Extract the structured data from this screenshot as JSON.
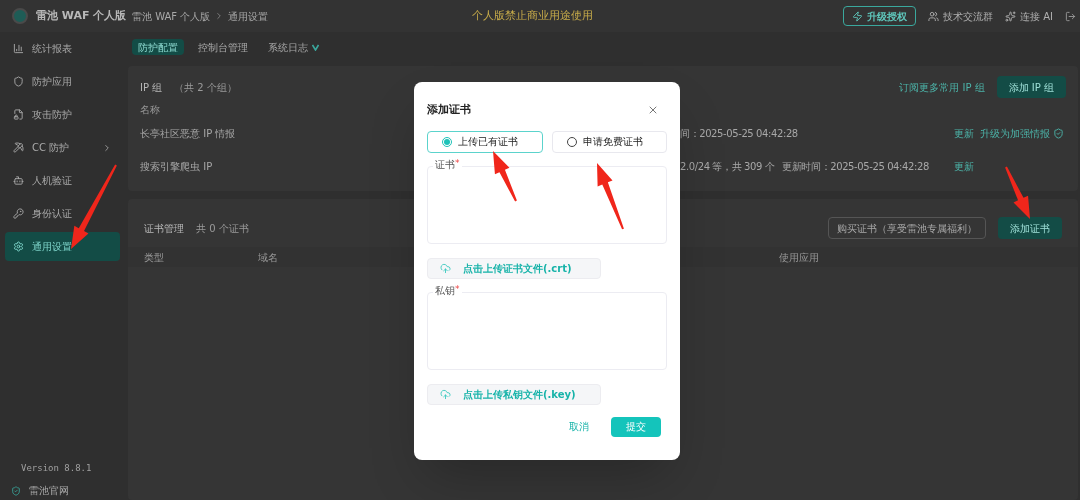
{
  "header": {
    "product": "雷池 WAF 个人版",
    "breadcrumb": [
      "雷池 WAF 个人版",
      "通用设置"
    ],
    "notice": "个人版禁止商业用途使用",
    "actions": [
      {
        "kind": "upgrade",
        "label": "升级授权"
      },
      {
        "kind": "group",
        "label": "技术交流群"
      },
      {
        "kind": "ai",
        "label": "连接 AI"
      }
    ]
  },
  "sidebar": {
    "items": [
      {
        "label": "统计报表",
        "selected": false,
        "expandable": false
      },
      {
        "label": "防护应用",
        "selected": false,
        "expandable": false
      },
      {
        "label": "攻击防护",
        "selected": false,
        "expandable": false
      },
      {
        "label": "CC 防护",
        "selected": false,
        "expandable": true
      },
      {
        "label": "人机验证",
        "selected": false,
        "expandable": false
      },
      {
        "label": "身份认证",
        "selected": false,
        "expandable": false
      },
      {
        "label": "通用设置",
        "selected": true,
        "expandable": false
      }
    ],
    "version": "Version 8.8.1",
    "footer_link": "雷池官网"
  },
  "tabs": [
    {
      "label": "防护配置",
      "selected": true,
      "badge": false
    },
    {
      "label": "控制台管理",
      "selected": false,
      "badge": false
    },
    {
      "label": "系统日志",
      "selected": false,
      "badge": true
    }
  ],
  "ip_group": {
    "title": "IP 组",
    "count": "（共 2 个组）",
    "subscribe_link": "订阅更多常用 IP 组",
    "add_button": "添加 IP 组",
    "columns": [
      "名称"
    ],
    "rows": [
      {
        "name": "长亭社区恶意 IP 情报",
        "details": [
          "间：2025-05-25 04:42:28"
        ],
        "action": "更新",
        "upgrade": "升级为加强情报"
      },
      {
        "name": "搜索引擎爬虫 IP",
        "details": [
          "2.0/24 等，共 309 个",
          "更新时间：2025-05-25 04:42:28"
        ],
        "action": "更新"
      }
    ]
  },
  "certificates": {
    "title": "证书管理",
    "count": "共 0 个证书",
    "buy_button": "购买证书（享受雷池专属福利）",
    "add_button": "添加证书",
    "columns": [
      "类型",
      "域名",
      "使用应用"
    ]
  },
  "dialog": {
    "title": "添加证书",
    "options": [
      {
        "label": "上传已有证书",
        "selected": true
      },
      {
        "label": "申请免费证书",
        "selected": false
      }
    ],
    "cert_field": {
      "label": "证书",
      "required": true,
      "required_mark": "*"
    },
    "cert_upload": "点击上传证书文件(.crt)",
    "key_field": {
      "label": "私钥",
      "required": true,
      "required_mark": "*"
    },
    "key_upload": "点击上传私钥文件(.key)",
    "cancel": "取消",
    "submit": "提交"
  }
}
